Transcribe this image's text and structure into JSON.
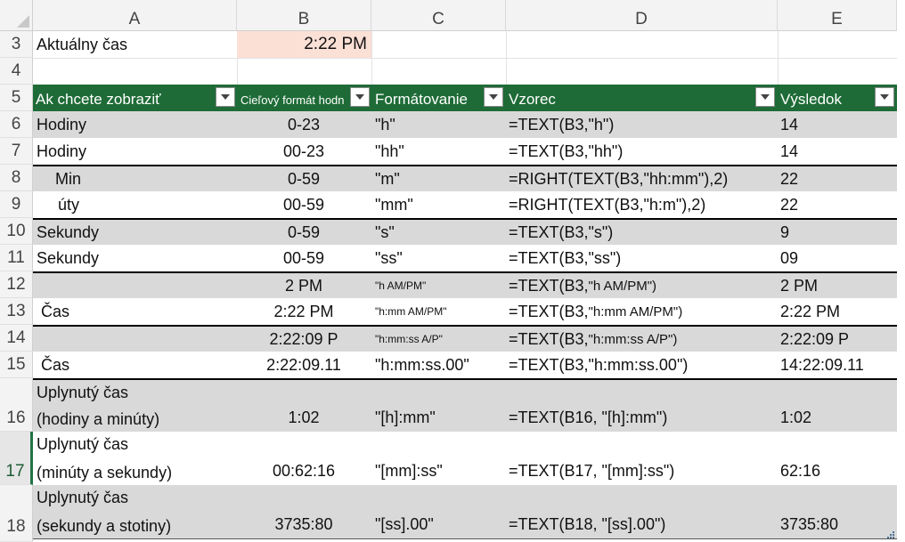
{
  "columns": [
    "A",
    "B",
    "C",
    "D",
    "E"
  ],
  "rows": [
    {
      "num": "3",
      "label": "Aktuálny čas",
      "value": "2:22 PM"
    },
    {
      "num": "4"
    }
  ],
  "table_header": {
    "row_num": "5",
    "a": "Ak chcete zobraziť",
    "b": "Cieľový formát hodn",
    "c": "Formátovanie",
    "d": "Vzorec",
    "e": "Výsledok"
  },
  "table_rows": [
    {
      "num": "6",
      "a": "Hodiny",
      "b": "0-23",
      "c": "\"h\"",
      "d": "=TEXT(B3,\"h\")",
      "e": "14"
    },
    {
      "num": "7",
      "a": "Hodiny",
      "b": "00-23",
      "c": "\"hh\"",
      "d": "=TEXT(B3,\"hh\")",
      "e": "14"
    },
    {
      "num": "8",
      "a": "Min",
      "b": "0-59",
      "c": "\"m\"",
      "d": "=RIGHT(TEXT(B3,\"hh:mm\"),2)",
      "e": "22"
    },
    {
      "num": "9",
      "a": "úty",
      "b": "00-59",
      "c": "\"mm\"",
      "d": "=RIGHT(TEXT(B3,\"h:m\"),2)",
      "e": "22"
    },
    {
      "num": "10",
      "a": "Sekundy",
      "b": "0-59",
      "c": "\"s\"",
      "d": "=TEXT(B3,\"s\")",
      "e": "9"
    },
    {
      "num": "11",
      "a": "Sekundy",
      "b": "00-59",
      "c": "\"ss\"",
      "d": "=TEXT(B3,\"ss\")",
      "e": "09"
    },
    {
      "num": "12",
      "a": "",
      "b": "2 PM",
      "c": "\"h AM/PM\"",
      "d1": "=TEXT(B3,",
      "d2": "\"h AM/PM\")",
      "e": "2 PM"
    },
    {
      "num": "13",
      "a": "Čas",
      "b": "2:22 PM",
      "c": "\"h:mm AM/PM\"",
      "d1": "=TEXT(B3,",
      "d2": "\"h:mm AM/PM\")",
      "e": "2:22 PM"
    },
    {
      "num": "14",
      "a": "",
      "b": "2:22:09 P",
      "c": "\"h:mm:ss A/P\"",
      "d1": "=TEXT(B3,",
      "d2": "\"h:mm:ss A/P\")",
      "e": "2:22:09 P"
    },
    {
      "num": "15",
      "a": "Čas",
      "b": "2:22:09.11",
      "c": "\"h:mm:ss.00\"",
      "d": "=TEXT(B3,\"h:mm:ss.00\")",
      "e": "14:22:09.11"
    },
    {
      "num": "16",
      "a1": "Uplynutý čas",
      "a2": "(hodiny a minúty)",
      "b": "1:02",
      "c": "\"[h]:mm\"",
      "d": "=TEXT(B16, \"[h]:mm\")",
      "e": "1:02"
    },
    {
      "num": "17",
      "a1": "Uplynutý čas",
      "a2": "(minúty a sekundy)",
      "b": "00:62:16",
      "c": "\"[mm]:ss\"",
      "d": "=TEXT(B17, \"[mm]:ss\")",
      "e": "62:16"
    },
    {
      "num": "18",
      "a1": "Uplynutý čas",
      "a2": "(sekundy a stotiny)",
      "b": "3735:80",
      "c": "\"[ss].00\"",
      "d": "=TEXT(B18, \"[ss].00\")",
      "e": "3735:80"
    }
  ],
  "colors": {
    "header_green": "#1e6b37",
    "band_gray": "#d9d9d9",
    "highlight_cell": "#fbe0d6",
    "selected_row_accent": "#217346"
  }
}
